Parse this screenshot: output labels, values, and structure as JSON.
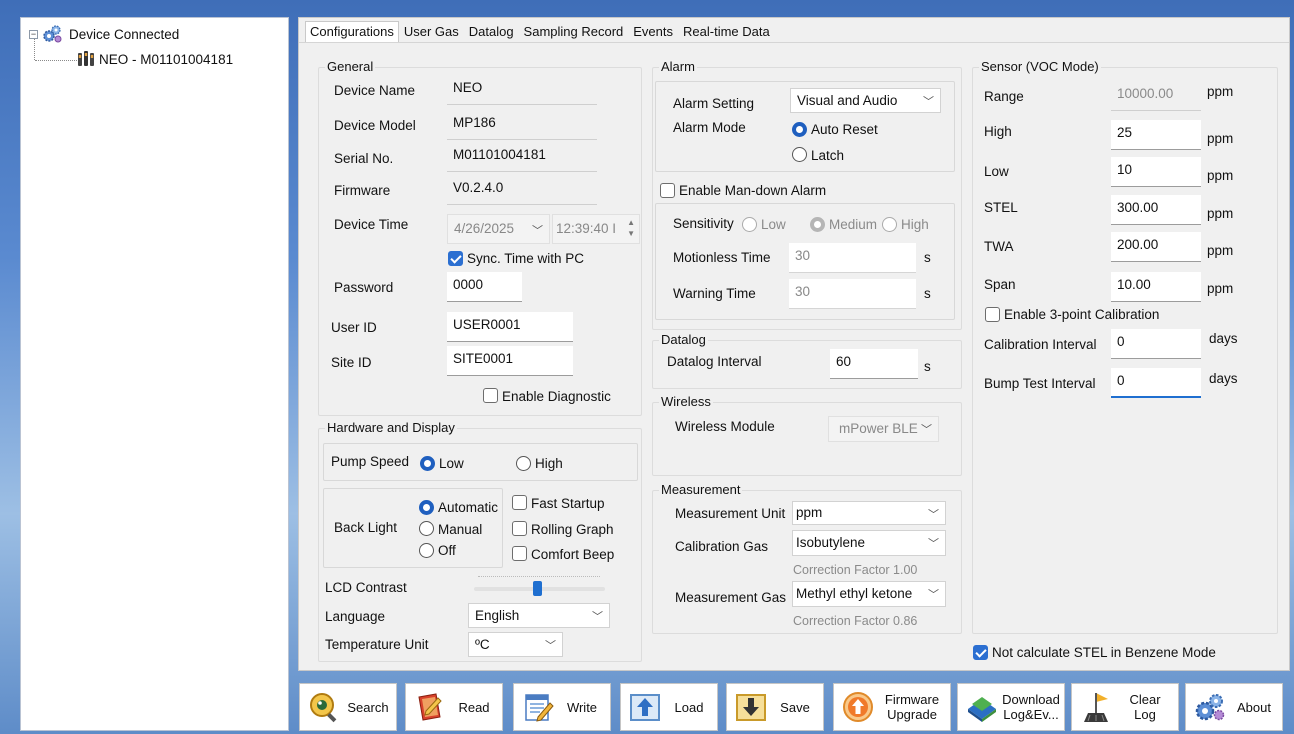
{
  "tree": {
    "root_label": "Device Connected",
    "device_label": "NEO - M01101004181"
  },
  "tabs": [
    "Configurations",
    "User Gas",
    "Datalog",
    "Sampling Record",
    "Events",
    "Real-time Data"
  ],
  "general": {
    "title": "General",
    "device_name_label": "Device Name",
    "device_name": "NEO",
    "device_model_label": "Device Model",
    "device_model": "MP186",
    "serial_label": "Serial No.",
    "serial": "M01101004181",
    "firmware_label": "Firmware",
    "firmware": "V0.2.4.0",
    "device_time_label": "Device Time",
    "device_date": "4/26/2025",
    "device_clock": "12:39:40 I",
    "sync_label": "Sync. Time with PC",
    "password_label": "Password",
    "password": "0000",
    "user_id_label": "User ID",
    "user_id": "USER0001",
    "site_id_label": "Site ID",
    "site_id": "SITE0001",
    "diagnostic_label": "Enable Diagnostic"
  },
  "hardware": {
    "title": "Hardware and Display",
    "pump_speed_label": "Pump Speed",
    "pump_low": "Low",
    "pump_high": "High",
    "backlight_label": "Back Light",
    "bl_automatic": "Automatic",
    "bl_manual": "Manual",
    "bl_off": "Off",
    "fast_startup": "Fast Startup",
    "rolling_graph": "Rolling Graph",
    "comfort_beep": "Comfort Beep",
    "lcd_contrast_label": "LCD Contrast",
    "language_label": "Language",
    "language": "English",
    "temp_unit_label": "Temperature Unit",
    "temp_unit": "ºC"
  },
  "alarm": {
    "title": "Alarm",
    "setting_label": "Alarm Setting",
    "setting": "Visual and Audio",
    "mode_label": "Alarm Mode",
    "auto_reset": "Auto Reset",
    "latch": "Latch",
    "mandown_label": "Enable Man-down Alarm",
    "sensitivity_label": "Sensitivity",
    "sens_low": "Low",
    "sens_medium": "Medium",
    "sens_high": "High",
    "motionless_label": "Motionless Time",
    "motionless": "30",
    "warning_label": "Warning Time",
    "warning": "30",
    "unit_s": "s"
  },
  "datalog": {
    "title": "Datalog",
    "interval_label": "Datalog Interval",
    "interval": "60",
    "unit": "s"
  },
  "wireless": {
    "title": "Wireless",
    "module_label": "Wireless Module",
    "module": "mPower BLE"
  },
  "measurement": {
    "title": "Measurement",
    "unit_label": "Measurement Unit",
    "unit": "ppm",
    "cal_gas_label": "Calibration Gas",
    "cal_gas": "Isobutylene",
    "cal_cf": "Correction Factor  1.00",
    "meas_gas_label": "Measurement Gas",
    "meas_gas": "Methyl ethyl ketone",
    "meas_cf": "Correction Factor  0.86"
  },
  "sensor": {
    "title": "Sensor (VOC Mode)",
    "range_label": "Range",
    "range": "10000.00",
    "high_label": "High",
    "high": "25",
    "low_label": "Low",
    "low": "10",
    "stel_label": "STEL",
    "stel": "300.00",
    "twa_label": "TWA",
    "twa": "200.00",
    "span_label": "Span",
    "span": "10.00",
    "ppm": "ppm",
    "three_point_label": "Enable 3-point Calibration",
    "cal_interval_label": "Calibration Interval",
    "cal_interval": "0",
    "bump_interval_label": "Bump Test Interval",
    "bump_interval": "0",
    "days": "days",
    "benzene_label": "Not calculate STEL in Benzene Mode"
  },
  "toolbar": {
    "search": "Search",
    "read": "Read",
    "write": "Write",
    "load": "Load",
    "save": "Save",
    "firmware_1": "Firmware",
    "firmware_2": "Upgrade",
    "download_1": "Download",
    "download_2": "Log&Ev...",
    "clear_1": "Clear",
    "clear_2": "Log",
    "about": "About"
  },
  "colors": {
    "accent": "#2b6fd1",
    "background_blue": "#5a8ad0"
  }
}
